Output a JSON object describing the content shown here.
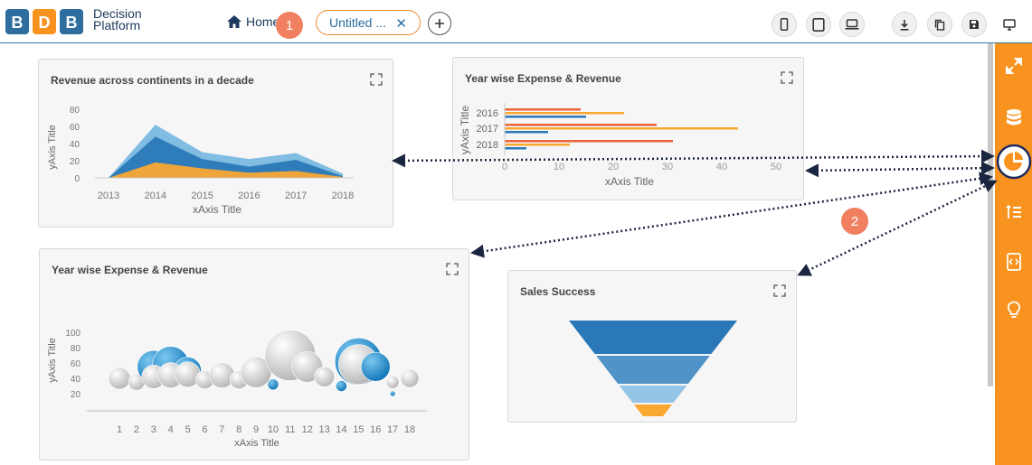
{
  "app": {
    "logo_text_line1": "Decision",
    "logo_text_line2": "Platform",
    "home_label": "Home",
    "tab_label": "Untitled ..."
  },
  "colors": {
    "accent": "#f7931e",
    "badge": "#f08060",
    "brand_blue": "#2d6e9e"
  },
  "callouts": {
    "one": "1",
    "two": "2"
  },
  "toolbar": {
    "icons": [
      "mobile-icon",
      "tablet-icon",
      "laptop-icon",
      "download-icon",
      "copy-icon",
      "save-icon",
      "monitor-icon"
    ]
  },
  "sidebar": {
    "icons": [
      "expand-icon",
      "database-icon",
      "pie-chart-icon",
      "sort-list-icon",
      "code-icon",
      "lightbulb-icon"
    ]
  },
  "charts": {
    "area": {
      "title": "Revenue across continents in a decade",
      "xlabel": "xAxis Title",
      "ylabel": "yAxis Title",
      "yticks": [
        "80",
        "60",
        "40",
        "20",
        "0"
      ],
      "xticks": [
        "2013",
        "2014",
        "2015",
        "2016",
        "2017",
        "2018"
      ]
    },
    "hbar": {
      "title": "Year wise Expense & Revenue",
      "xlabel": "xAxis Title",
      "ylabel": "yAxis Title",
      "yticks": [
        "2016",
        "2017",
        "2018"
      ],
      "xticks": [
        "0",
        "10",
        "20",
        "30",
        "40",
        "50"
      ]
    },
    "bubble": {
      "title": "Year wise Expense & Revenue",
      "xlabel": "xAxis Title",
      "ylabel": "yAxis Title",
      "yticks": [
        "100",
        "80",
        "60",
        "40",
        "20"
      ],
      "xticks": [
        "1",
        "2",
        "3",
        "4",
        "5",
        "6",
        "7",
        "8",
        "9",
        "10",
        "11",
        "12",
        "13",
        "14",
        "15",
        "16",
        "17",
        "18"
      ]
    },
    "funnel": {
      "title": "Sales Success"
    }
  },
  "chart_data": [
    {
      "type": "area",
      "title": "Revenue across continents in a decade",
      "xlabel": "xAxis Title",
      "ylabel": "yAxis Title",
      "categories": [
        "2013",
        "2014",
        "2015",
        "2016",
        "2017",
        "2018"
      ],
      "ylim": [
        0,
        80
      ],
      "series": [
        {
          "values": [
            0,
            62,
            30,
            22,
            29,
            5
          ]
        },
        {
          "values": [
            0,
            48,
            22,
            13,
            21,
            2
          ]
        },
        {
          "values": [
            0,
            18,
            11,
            6,
            8,
            1
          ]
        }
      ]
    },
    {
      "type": "bar",
      "orientation": "horizontal",
      "title": "Year wise Expense & Revenue",
      "xlabel": "xAxis Title",
      "ylabel": "yAxis Title",
      "categories": [
        "2016",
        "2017",
        "2018"
      ],
      "xlim": [
        0,
        50
      ],
      "series": [
        {
          "values": [
            14,
            28,
            31
          ]
        },
        {
          "values": [
            22,
            43,
            12
          ]
        },
        {
          "values": [
            15,
            8,
            4
          ]
        }
      ]
    },
    {
      "type": "scatter",
      "title": "Year wise Expense & Revenue",
      "xlabel": "xAxis Title",
      "ylabel": "yAxis Title",
      "x": [
        1,
        2,
        3,
        4,
        5,
        6,
        7,
        8,
        9,
        10,
        11,
        12,
        13,
        14,
        15,
        16,
        17,
        18
      ],
      "ylim": [
        0,
        100
      ],
      "points": [
        {
          "x": 1,
          "y": 40,
          "r": 12,
          "c": "g"
        },
        {
          "x": 2,
          "y": 35,
          "r": 9,
          "c": "g"
        },
        {
          "x": 3,
          "y": 55,
          "r": 18,
          "c": "b"
        },
        {
          "x": 4,
          "y": 58,
          "r": 20,
          "c": "b"
        },
        {
          "x": 5,
          "y": 50,
          "r": 15,
          "c": "b"
        },
        {
          "x": 3,
          "y": 42,
          "r": 13,
          "c": "g"
        },
        {
          "x": 4,
          "y": 44,
          "r": 14,
          "c": "g"
        },
        {
          "x": 5,
          "y": 45,
          "r": 14,
          "c": "g"
        },
        {
          "x": 6,
          "y": 38,
          "r": 10,
          "c": "g"
        },
        {
          "x": 7,
          "y": 44,
          "r": 14,
          "c": "g"
        },
        {
          "x": 8,
          "y": 38,
          "r": 10,
          "c": "g"
        },
        {
          "x": 9,
          "y": 48,
          "r": 17,
          "c": "g"
        },
        {
          "x": 10,
          "y": 32,
          "r": 6,
          "c": "b"
        },
        {
          "x": 11,
          "y": 70,
          "r": 28,
          "c": "g"
        },
        {
          "x": 12,
          "y": 55,
          "r": 17,
          "c": "g"
        },
        {
          "x": 13,
          "y": 42,
          "r": 11,
          "c": "g"
        },
        {
          "x": 14,
          "y": 30,
          "r": 6,
          "c": "b"
        },
        {
          "x": 15,
          "y": 62,
          "r": 26,
          "c": "b"
        },
        {
          "x": 15,
          "y": 58,
          "r": 22,
          "c": "g"
        },
        {
          "x": 16,
          "y": 55,
          "r": 16,
          "c": "b"
        },
        {
          "x": 17,
          "y": 35,
          "r": 7,
          "c": "g"
        },
        {
          "x": 18,
          "y": 40,
          "r": 10,
          "c": "g"
        },
        {
          "x": 17,
          "y": 20,
          "r": 3,
          "c": "b"
        }
      ]
    },
    {
      "type": "funnel",
      "title": "Sales Success",
      "stages": 4
    }
  ]
}
